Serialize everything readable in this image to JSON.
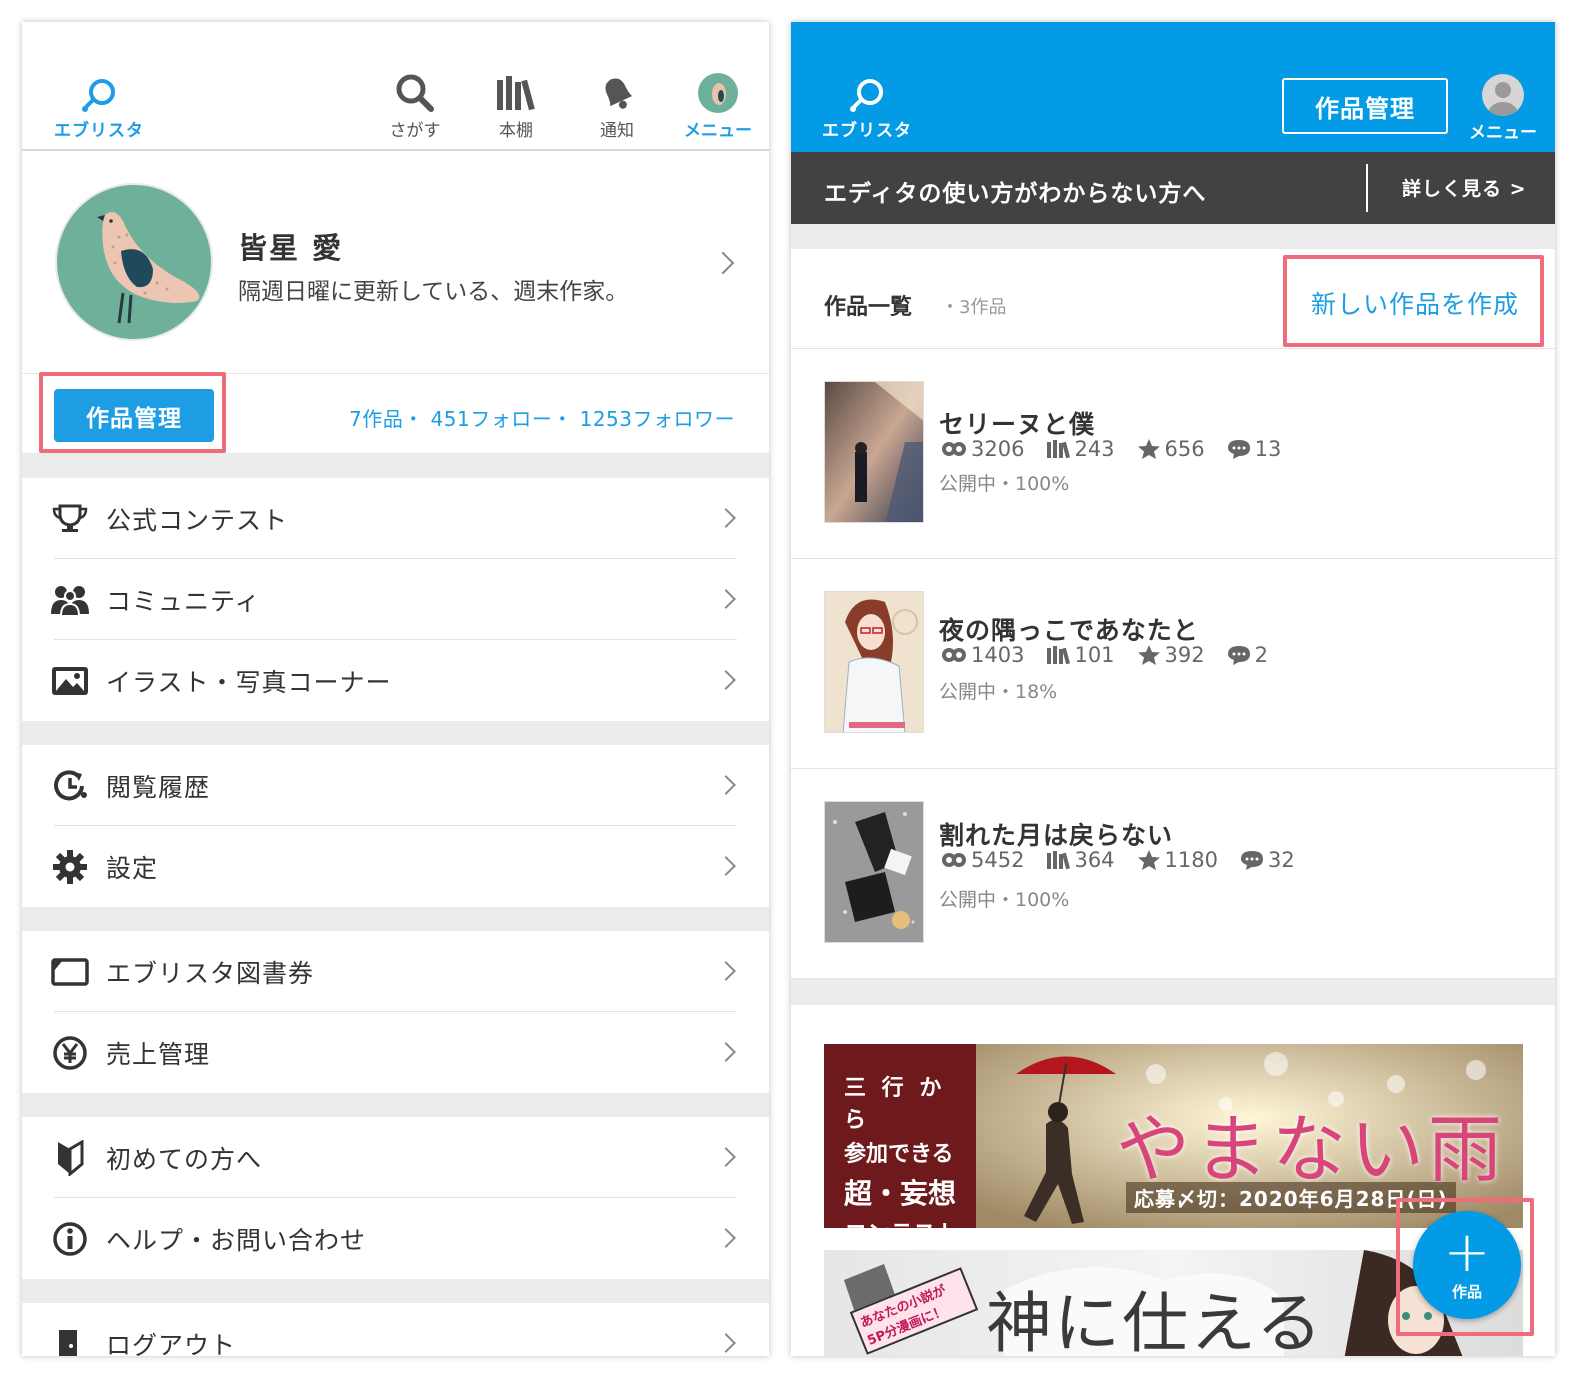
{
  "left": {
    "header": {
      "logo_text": "エブリスタ",
      "nav": [
        {
          "label": "さがす",
          "icon": "search-icon"
        },
        {
          "label": "本棚",
          "icon": "bookshelf-icon"
        },
        {
          "label": "通知",
          "icon": "bell-icon"
        },
        {
          "label": "メニュー",
          "icon": "avatar-icon"
        }
      ]
    },
    "profile": {
      "name": "皆星 愛",
      "description": "隔週日曜に更新している、週末作家。"
    },
    "manage_button": "作品管理",
    "stats": "7作品・ 451フォロー・ 1253フォロワー",
    "menu_groups": [
      [
        {
          "label": "公式コンテスト",
          "icon": "trophy-icon"
        },
        {
          "label": "コミュニティ",
          "icon": "people-icon"
        },
        {
          "label": "イラスト・写真コーナー",
          "icon": "image-icon"
        }
      ],
      [
        {
          "label": "閲覧履歴",
          "icon": "history-icon"
        },
        {
          "label": "設定",
          "icon": "gear-icon"
        }
      ],
      [
        {
          "label": "エブリスタ図書券",
          "icon": "ticket-icon"
        },
        {
          "label": "売上管理",
          "icon": "yen-icon"
        }
      ],
      [
        {
          "label": "初めての方へ",
          "icon": "beginner-mark-icon"
        },
        {
          "label": "ヘルプ・お問い合わせ",
          "icon": "info-icon"
        }
      ],
      [
        {
          "label": "ログアウト",
          "icon": "logout-icon"
        }
      ]
    ]
  },
  "right": {
    "header": {
      "logo_text": "エブリスタ",
      "manage_button": "作品管理",
      "menu_label": "メニュー"
    },
    "guide": {
      "text": "エディタの使い方がわからない方へ",
      "link": "詳しく見る >"
    },
    "list": {
      "title": "作品一覧",
      "count": "・3作品",
      "new_link": "新しい作品を作成"
    },
    "works": [
      {
        "title": "セリーヌと僕",
        "views": "3206",
        "shelf": "243",
        "stars": "656",
        "comments": "13",
        "status": "公開中・100%"
      },
      {
        "title": "夜の隅っこであなたと",
        "views": "1403",
        "shelf": "101",
        "stars": "392",
        "comments": "2",
        "status": "公開中・18%"
      },
      {
        "title": "割れた月は戻らない",
        "views": "5452",
        "shelf": "364",
        "stars": "1180",
        "comments": "32",
        "status": "公開中・100%"
      }
    ],
    "banner1": {
      "left_lines": [
        "三 行 か ら",
        "参加できる",
        "超・妄想",
        "コンテスト"
      ],
      "title": "やまない雨",
      "deadline": "応募〆切：2020年6月28日(日)"
    },
    "banner2": {
      "badge": "あなたの小説が5P分漫画に！",
      "title": "神に仕える"
    },
    "fab_label": "作品"
  },
  "colors": {
    "accent": "#039be5",
    "highlight": "#ef6c7c",
    "guide_bg": "#424242"
  }
}
